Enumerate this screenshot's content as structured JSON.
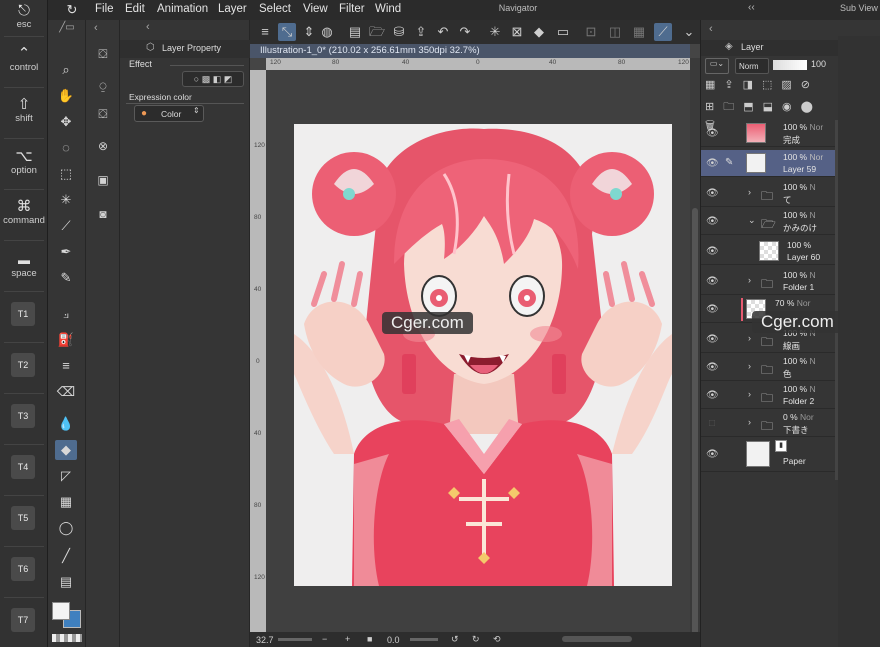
{
  "menubar": {
    "items": [
      "File",
      "Edit",
      "Animation",
      "Layer",
      "Select",
      "View",
      "Window"
    ],
    "window_truncated": "Wind",
    "navigator_label": "Navigator",
    "subview_label": "Sub View"
  },
  "shortcuts": {
    "esc": "esc",
    "control": "control",
    "shift": "shift",
    "option": "option",
    "command": "command",
    "space": "space",
    "tkeys": [
      "T1",
      "T2",
      "T3",
      "T4",
      "T5",
      "T6",
      "T7"
    ]
  },
  "property_panel": {
    "title": "Layer Property",
    "effect_label": "Effect",
    "expression_color_label": "Expression color",
    "expression_color_value": "Color"
  },
  "document": {
    "tab_title": "Illustration-1_0* (210.02 x 256.61mm 350dpi 32.7%)",
    "ruler_top_labels": [
      "120",
      "80",
      "40",
      "0",
      "40",
      "80",
      "120"
    ],
    "ruler_left_labels": [
      "120",
      "80",
      "40",
      "0",
      "40",
      "80",
      "120"
    ],
    "zoom_value": "32.7",
    "angle_value": "0.0"
  },
  "watermark": "Cger.com",
  "layer_panel": {
    "title": "Layer",
    "blend_mode": "Norm",
    "opacity": "100",
    "layers": [
      {
        "pct": "100 %",
        "mode": "Nor",
        "name": "完成",
        "kind": "thumb-art",
        "visible": true,
        "selected": false
      },
      {
        "pct": "100 %",
        "mode": "Nor",
        "name": "Layer 59",
        "kind": "thumb",
        "visible": true,
        "selected": true
      },
      {
        "pct": "100 %",
        "mode": "N",
        "name": "て",
        "kind": "folder",
        "visible": true,
        "selected": false
      },
      {
        "pct": "100 %",
        "mode": "N",
        "name": "かみのけ",
        "kind": "folder-open",
        "visible": true,
        "selected": false
      },
      {
        "pct": "100 %",
        "mode": "",
        "name": "Layer 60",
        "kind": "thumb-checker",
        "visible": true,
        "selected": false
      },
      {
        "pct": "100 %",
        "mode": "N",
        "name": "Folder 1",
        "kind": "folder",
        "visible": true,
        "selected": false
      },
      {
        "pct": "70 %",
        "mode": "Nor",
        "name": "",
        "kind": "thumb-checker",
        "visible": true,
        "selected": false
      },
      {
        "pct": "100 %",
        "mode": "N",
        "name": "線画",
        "kind": "folder",
        "visible": true,
        "selected": false
      },
      {
        "pct": "100 %",
        "mode": "N",
        "name": "色",
        "kind": "folder",
        "visible": true,
        "selected": false
      },
      {
        "pct": "100 %",
        "mode": "N",
        "name": "Folder 2",
        "kind": "folder",
        "visible": true,
        "selected": false
      },
      {
        "pct": "0 %",
        "mode": "Nor",
        "name": "下書き",
        "kind": "folder",
        "visible": false,
        "selected": false
      },
      {
        "pct": "",
        "mode": "",
        "name": "Paper",
        "kind": "thumb-paper",
        "visible": true,
        "selected": false
      }
    ]
  },
  "colors": {
    "accent": "#4f6c8f",
    "selected_layer": "#556186",
    "hair": "#ec5f74",
    "dress": "#e8435d",
    "skin": "#f7d5cc"
  }
}
